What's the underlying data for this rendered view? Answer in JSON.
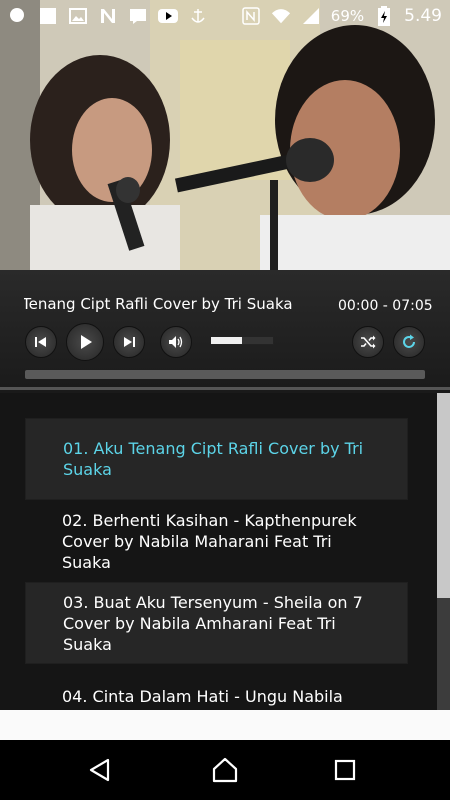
{
  "status_bar": {
    "left_icons": [
      "app-icon",
      "image-icon",
      "gallery-icon",
      "n-app-icon",
      "message-icon",
      "youtube-icon",
      "anchor-icon"
    ],
    "right_icons": [
      "nfc-icon",
      "wifi-icon",
      "signal-icon",
      "battery-icon"
    ],
    "battery": "69%",
    "time": "5.49"
  },
  "player": {
    "now_playing": "Tenang Cipt Rafli Cover by Tri Suaka",
    "time": "00:00 - 07:05",
    "volume_level": 0.5,
    "progress": 0.0,
    "controls": [
      "previous",
      "play",
      "next",
      "volume",
      "shuffle",
      "repeat"
    ]
  },
  "playlist": {
    "items": [
      {
        "label": "01. Aku Tenang Cipt Rafli Cover by Tri Suaka"
      },
      {
        "label": "02. Berhenti Kasihan - Kapthenpurek Cover by Nabila Maharani Feat Tri Suaka"
      },
      {
        "label": "03. Buat Aku Tersenyum - Sheila on 7 Cover by Nabila Amharani Feat Tri Suaka"
      },
      {
        "label": "04. Cinta Dalam Hati - Ungu Nabila"
      }
    ],
    "active_index": 0
  },
  "nav": {
    "buttons": [
      "back",
      "home",
      "recents"
    ]
  },
  "colors": {
    "accent": "#5cd4e8",
    "item_bg": "#262626",
    "list_bg": "#151515"
  }
}
